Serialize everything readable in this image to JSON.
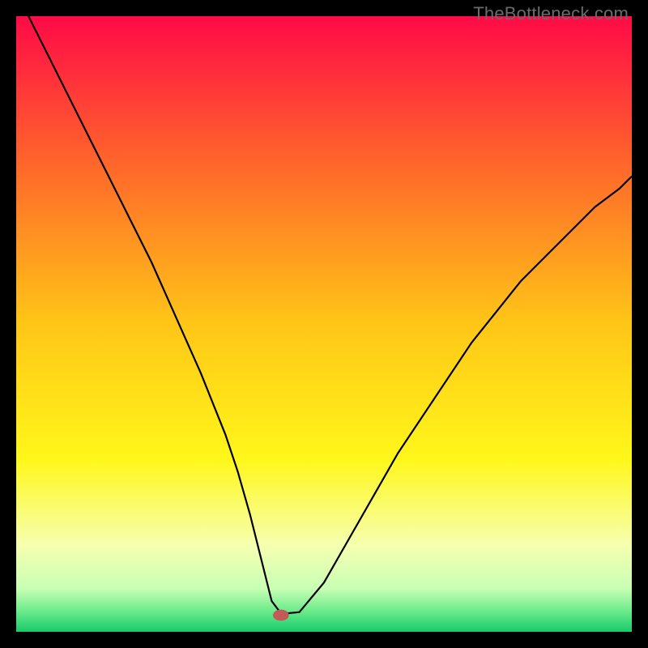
{
  "watermark": "TheBottleneck.com",
  "chart_data": {
    "type": "line",
    "title": "",
    "xlabel": "",
    "ylabel": "",
    "xlim": [
      0,
      100
    ],
    "ylim": [
      0,
      100
    ],
    "grid": false,
    "legend": false,
    "annotations": [],
    "background_gradient": {
      "stops": [
        {
          "pos": 0.0,
          "color": "#ff0a46"
        },
        {
          "pos": 0.25,
          "color": "#ff6a2a"
        },
        {
          "pos": 0.5,
          "color": "#ffc617"
        },
        {
          "pos": 0.72,
          "color": "#fff71a"
        },
        {
          "pos": 0.86,
          "color": "#f6ffb0"
        },
        {
          "pos": 0.93,
          "color": "#c8ffb4"
        },
        {
          "pos": 0.97,
          "color": "#61e887"
        },
        {
          "pos": 1.0,
          "color": "#18c96a"
        }
      ]
    },
    "series": [
      {
        "name": "bottleneck-curve",
        "color": "#000000",
        "x": [
          2,
          6,
          10,
          14,
          18,
          22,
          26,
          30,
          34,
          36,
          38,
          40,
          41.5,
          43,
          44,
          46,
          50,
          54,
          58,
          62,
          66,
          70,
          74,
          78,
          82,
          86,
          90,
          94,
          98,
          100
        ],
        "y": [
          100,
          92,
          84,
          76,
          68,
          60,
          51,
          42,
          32,
          26,
          19,
          11,
          5,
          3,
          3,
          3.2,
          8,
          15,
          22,
          29,
          35,
          41,
          47,
          52,
          57,
          61,
          65,
          69,
          72,
          74
        ]
      }
    ],
    "marker": {
      "name": "optimal-point",
      "x": 43,
      "y": 2.7,
      "rx": 1.3,
      "ry": 0.9,
      "color": "#c45a57"
    }
  }
}
